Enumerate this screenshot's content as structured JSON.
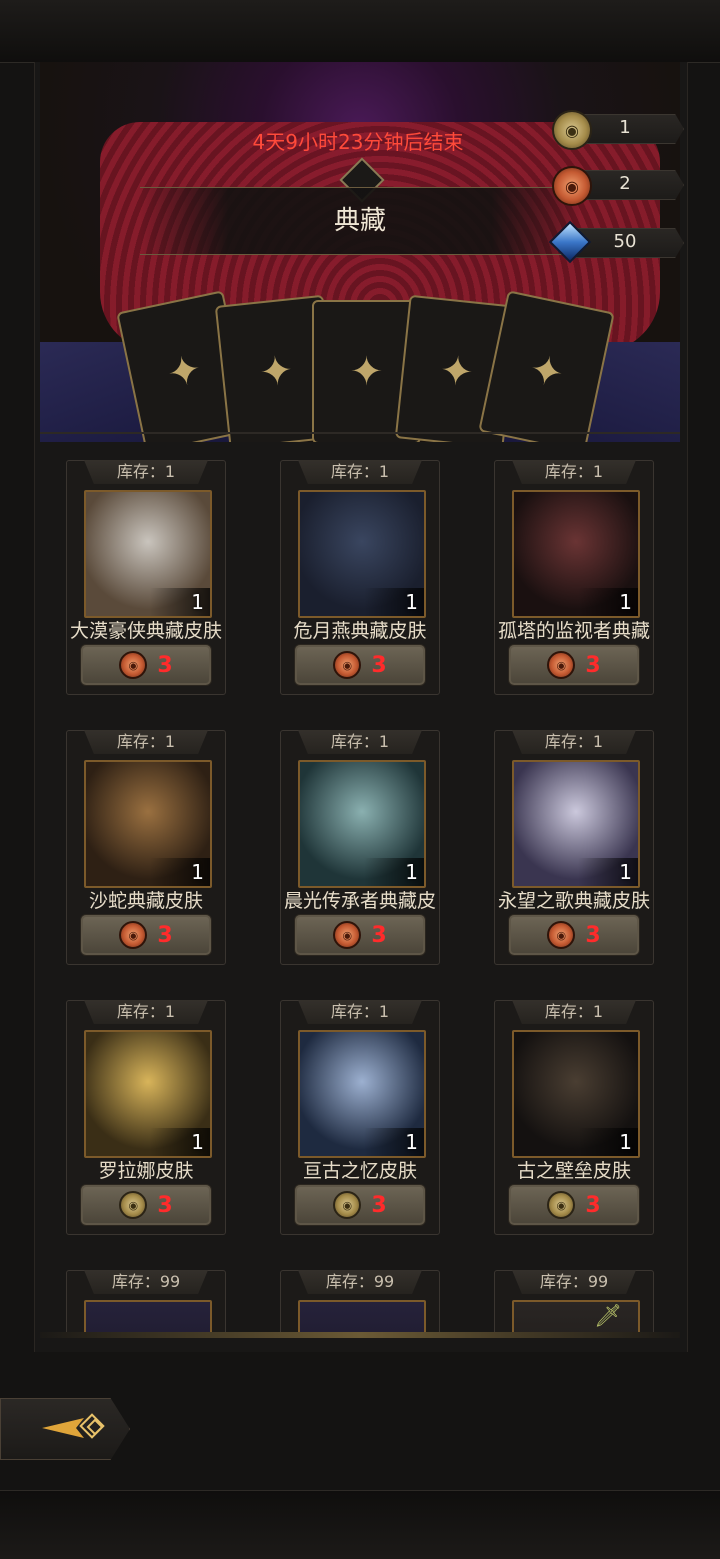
{
  "event": {
    "timer_text": "4天9小时23分钟后结束",
    "title": "典藏"
  },
  "currency": [
    {
      "icon": "gold-coin-icon",
      "value": "1"
    },
    {
      "icon": "copper-coin-icon",
      "value": "2"
    },
    {
      "icon": "blue-crystal-icon",
      "value": "50"
    }
  ],
  "items": [
    {
      "stock": "库存：1",
      "name": "大漠豪侠典藏皮肤",
      "count": "1",
      "price": "3",
      "coin": "copper",
      "palette": [
        "#c9c4bd",
        "#5a4a3a"
      ]
    },
    {
      "stock": "库存：1",
      "name": "危月燕典藏皮肤",
      "count": "1",
      "price": "3",
      "coin": "copper",
      "palette": [
        "#3a4660",
        "#1a1f2e"
      ]
    },
    {
      "stock": "库存：1",
      "name": "孤塔的监视者典藏",
      "count": "1",
      "price": "3",
      "coin": "copper",
      "palette": [
        "#3d2222",
        "#1a1010"
      ]
    },
    {
      "stock": "库存：1",
      "name": "沙蛇典藏皮肤",
      "count": "1",
      "price": "3",
      "coin": "copper",
      "palette": [
        "#7a5a34",
        "#2e2014"
      ]
    },
    {
      "stock": "库存：1",
      "name": "晨光传承者典藏皮",
      "count": "1",
      "price": "3",
      "coin": "copper",
      "palette": [
        "#6a8c8c",
        "#1f3538"
      ]
    },
    {
      "stock": "库存：1",
      "name": "永望之歌典藏皮肤",
      "count": "1",
      "price": "3",
      "coin": "copper",
      "palette": [
        "#b3b0c6",
        "#3a3550"
      ]
    },
    {
      "stock": "库存：1",
      "name": "罗拉娜皮肤",
      "count": "1",
      "price": "3",
      "coin": "gold",
      "palette": [
        "#c9a64a",
        "#3a2e16"
      ]
    },
    {
      "stock": "库存：1",
      "name": "亘古之忆皮肤",
      "count": "1",
      "price": "3",
      "coin": "gold",
      "palette": [
        "#8ca0c0",
        "#1e2a40"
      ]
    },
    {
      "stock": "库存：1",
      "name": "古之壁垒皮肤",
      "count": "1",
      "price": "3",
      "coin": "gold",
      "palette": [
        "#3a3028",
        "#141110"
      ]
    },
    {
      "stock": "库存：99",
      "name": "",
      "count": "",
      "price": "",
      "coin": "",
      "palette": [
        "#26223a",
        "#141220"
      ]
    },
    {
      "stock": "库存：99",
      "name": "",
      "count": "",
      "price": "",
      "coin": "",
      "palette": [
        "#26223a",
        "#141220"
      ]
    },
    {
      "stock": "库存：99",
      "name": "",
      "count": "",
      "price": "",
      "coin": "",
      "palette": [
        "#2a2624",
        "#141210"
      ]
    }
  ],
  "nav": {
    "back_icon": "back-arrow-icon"
  },
  "colors": {
    "timer": "#ff4a3a",
    "price": "#ff2b2b",
    "accent_gold": "#8a7446"
  }
}
